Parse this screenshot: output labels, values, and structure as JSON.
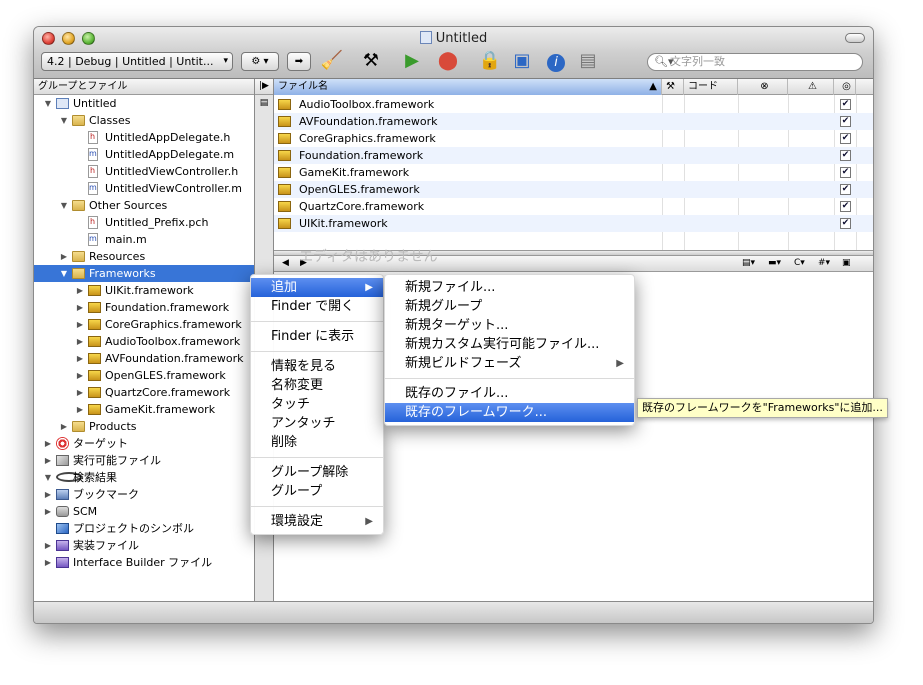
{
  "window": {
    "title": "Untitled"
  },
  "toolbar": {
    "config_popup": "4.2 | Debug | Untitled | Untit...",
    "search_placeholder": "文字列一致"
  },
  "groups_pane": {
    "header": "グループとファイル",
    "tree": [
      {
        "label": "Untitled",
        "icon": "project-icon",
        "indent": 0,
        "disclosure": "open"
      },
      {
        "label": "Classes",
        "icon": "folder-icon",
        "indent": 1,
        "disclosure": "open"
      },
      {
        "label": "UntitledAppDelegate.h",
        "icon": "header-file-icon",
        "indent": 2,
        "disclosure": ""
      },
      {
        "label": "UntitledAppDelegate.m",
        "icon": "implementation-file-icon",
        "indent": 2,
        "disclosure": ""
      },
      {
        "label": "UntitledViewController.h",
        "icon": "header-file-icon",
        "indent": 2,
        "disclosure": ""
      },
      {
        "label": "UntitledViewController.m",
        "icon": "implementation-file-icon",
        "indent": 2,
        "disclosure": ""
      },
      {
        "label": "Other Sources",
        "icon": "folder-icon",
        "indent": 1,
        "disclosure": "open"
      },
      {
        "label": "Untitled_Prefix.pch",
        "icon": "header-file-icon",
        "indent": 2,
        "disclosure": ""
      },
      {
        "label": "main.m",
        "icon": "implementation-file-icon",
        "indent": 2,
        "disclosure": ""
      },
      {
        "label": "Resources",
        "icon": "folder-icon",
        "indent": 1,
        "disclosure": "closed"
      },
      {
        "label": "Frameworks",
        "icon": "folder-icon",
        "indent": 1,
        "disclosure": "open",
        "selected": true
      },
      {
        "label": "UIKit.framework",
        "icon": "framework-icon",
        "indent": 2,
        "disclosure": "closed"
      },
      {
        "label": "Foundation.framework",
        "icon": "framework-icon",
        "indent": 2,
        "disclosure": "closed"
      },
      {
        "label": "CoreGraphics.framework",
        "icon": "framework-icon",
        "indent": 2,
        "disclosure": "closed"
      },
      {
        "label": "AudioToolbox.framework",
        "icon": "framework-icon",
        "indent": 2,
        "disclosure": "closed"
      },
      {
        "label": "AVFoundation.framework",
        "icon": "framework-icon",
        "indent": 2,
        "disclosure": "closed"
      },
      {
        "label": "OpenGLES.framework",
        "icon": "framework-icon",
        "indent": 2,
        "disclosure": "closed"
      },
      {
        "label": "QuartzCore.framework",
        "icon": "framework-icon",
        "indent": 2,
        "disclosure": "closed"
      },
      {
        "label": "GameKit.framework",
        "icon": "framework-icon",
        "indent": 2,
        "disclosure": "closed"
      },
      {
        "label": "Products",
        "icon": "folder-icon",
        "indent": 1,
        "disclosure": "closed"
      },
      {
        "label": "ターゲット",
        "icon": "target-icon",
        "indent": 0,
        "disclosure": "closed"
      },
      {
        "label": "実行可能ファイル",
        "icon": "executable-icon",
        "indent": 0,
        "disclosure": "closed"
      },
      {
        "label": "検索結果",
        "icon": "search-results-icon",
        "indent": 0,
        "disclosure": "open"
      },
      {
        "label": "ブックマーク",
        "icon": "bookmark-icon",
        "indent": 0,
        "disclosure": "closed"
      },
      {
        "label": "SCM",
        "icon": "scm-icon",
        "indent": 0,
        "disclosure": "closed"
      },
      {
        "label": "プロジェクトのシンボル",
        "icon": "symbols-icon",
        "indent": 0,
        "disclosure": ""
      },
      {
        "label": "実装ファイル",
        "icon": "smart-group-icon",
        "indent": 0,
        "disclosure": "closed"
      },
      {
        "label": "Interface Builder ファイル",
        "icon": "smart-group-icon",
        "indent": 0,
        "disclosure": "closed"
      }
    ]
  },
  "file_list": {
    "columns": {
      "filename": "ファイル名",
      "code": "コード",
      "errors_icon": "error-icon",
      "warnings_icon": "warning-icon",
      "target_icon": "target-membership-icon"
    },
    "rows": [
      {
        "name": "AudioToolbox.framework",
        "checked": true
      },
      {
        "name": "AVFoundation.framework",
        "checked": true
      },
      {
        "name": "CoreGraphics.framework",
        "checked": true
      },
      {
        "name": "Foundation.framework",
        "checked": true
      },
      {
        "name": "GameKit.framework",
        "checked": true
      },
      {
        "name": "OpenGLES.framework",
        "checked": true
      },
      {
        "name": "QuartzCore.framework",
        "checked": true
      },
      {
        "name": "UIKit.framework",
        "checked": true
      }
    ]
  },
  "editor": {
    "message": "エディタはありません"
  },
  "context_menu": {
    "items": [
      {
        "label": "追加",
        "submenu": true,
        "highlighted": true
      },
      {
        "label": "Finder で開く"
      },
      {
        "separator": true
      },
      {
        "label": "Finder に表示"
      },
      {
        "separator": true
      },
      {
        "label": "情報を見る"
      },
      {
        "label": "名称変更"
      },
      {
        "label": "タッチ"
      },
      {
        "label": "アンタッチ"
      },
      {
        "label": "削除"
      },
      {
        "separator": true
      },
      {
        "label": "グループ解除"
      },
      {
        "label": "グループ"
      },
      {
        "separator": true
      },
      {
        "label": "環境設定",
        "submenu": true
      }
    ]
  },
  "add_submenu": {
    "items": [
      {
        "label": "新規ファイル..."
      },
      {
        "label": "新規グループ"
      },
      {
        "label": "新規ターゲット..."
      },
      {
        "label": "新規カスタム実行可能ファイル..."
      },
      {
        "label": "新規ビルドフェーズ",
        "submenu": true
      },
      {
        "separator": true
      },
      {
        "label": "既存のファイル..."
      },
      {
        "label": "既存のフレームワーク...",
        "highlighted": true
      }
    ]
  },
  "tooltip": "既存のフレームワークを\"Frameworks\"に追加...",
  "colors": {
    "selection": "#3875d7",
    "menu_highlight": "#2562d9",
    "tooltip_bg": "#ffffc7"
  }
}
